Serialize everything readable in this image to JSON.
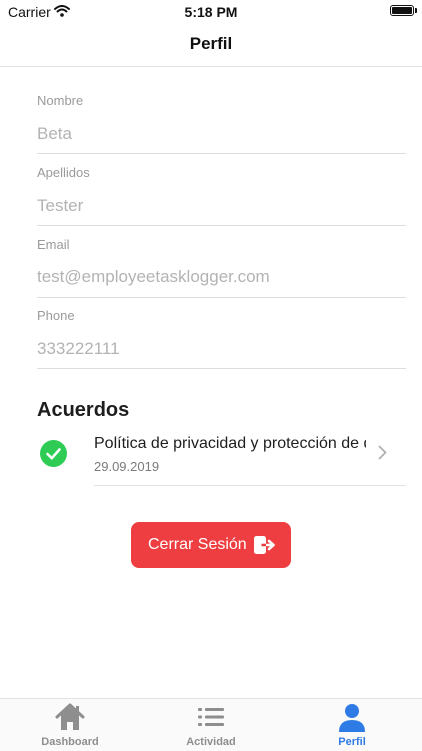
{
  "status_bar": {
    "carrier": "Carrier",
    "time": "5:18 PM"
  },
  "header": {
    "title": "Perfil"
  },
  "profile": {
    "fields": [
      {
        "label": "Nombre",
        "value": "Beta"
      },
      {
        "label": "Apellidos",
        "value": "Tester"
      },
      {
        "label": "Email",
        "value": "test@employeetasklogger.com"
      },
      {
        "label": "Phone",
        "value": "333222111"
      }
    ]
  },
  "agreements": {
    "title": "Acuerdos",
    "items": [
      {
        "title": "Política de privacidad y protección de datos",
        "date": "29.09.2019",
        "status": "accepted"
      }
    ]
  },
  "logout": {
    "label": "Cerrar Sesión"
  },
  "tabs": [
    {
      "label": "Dashboard",
      "icon": "home-icon"
    },
    {
      "label": "Actividad",
      "icon": "list-icon"
    },
    {
      "label": "Perfil",
      "icon": "person-icon",
      "active": true
    }
  ],
  "colors": {
    "accent": "#2f7be5",
    "danger": "#ee3e41",
    "success": "#2ecc55"
  }
}
